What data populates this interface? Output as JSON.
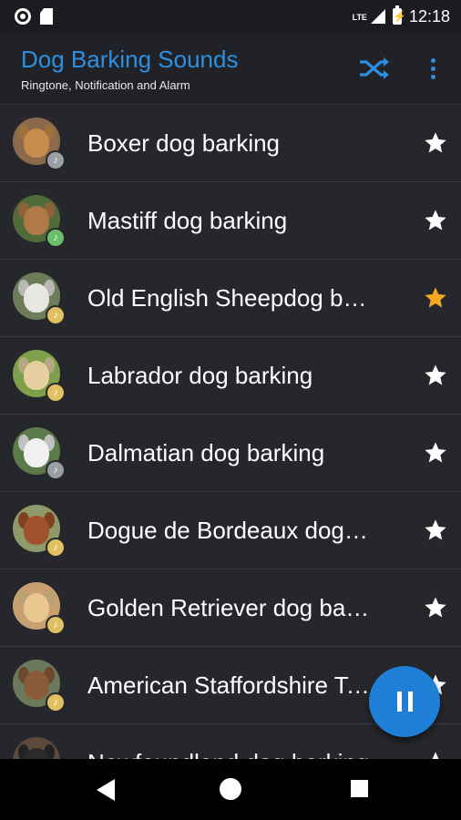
{
  "status_bar": {
    "time": "12:18",
    "network": "LTE"
  },
  "app_bar": {
    "title": "Dog Barking Sounds",
    "subtitle": "Ringtone, Notification and Alarm",
    "shuffle_icon": "shuffle-icon",
    "more_icon": "more-vert-icon"
  },
  "colors": {
    "accent": "#2e8fe0",
    "favorite": "#f5a623",
    "star": "#ffffff",
    "list_bg": "#26272c",
    "fab": "#1f7fd6"
  },
  "sounds": [
    {
      "title": "Boxer dog barking",
      "favorite": false,
      "avatar_bg": "#8a6a4a",
      "fur": "#c88b4e",
      "badge": "#9aa0a6"
    },
    {
      "title": "Mastiff dog barking",
      "favorite": false,
      "avatar_bg": "#4f6b3a",
      "fur": "#b07a48",
      "badge": "#6bbf6b"
    },
    {
      "title": "Old English Sheepdog barking",
      "favorite": true,
      "avatar_bg": "#6d7d5a",
      "fur": "#e8e6e0",
      "badge": "#e0c060"
    },
    {
      "title": "Labrador dog barking",
      "favorite": false,
      "avatar_bg": "#7fa04a",
      "fur": "#e6cfa0",
      "badge": "#e0c060"
    },
    {
      "title": "Dalmatian dog barking",
      "favorite": false,
      "avatar_bg": "#5b7a4a",
      "fur": "#f0f0f0",
      "badge": "#9aa0a6"
    },
    {
      "title": "Dogue de Bordeaux dog barking",
      "favorite": false,
      "avatar_bg": "#8e9a6a",
      "fur": "#a0522d",
      "badge": "#e0c060"
    },
    {
      "title": "Golden Retriever dog barking",
      "favorite": false,
      "avatar_bg": "#c8a070",
      "fur": "#e8c890",
      "badge": "#e0c060"
    },
    {
      "title": "American Staffordshire Terrier barking",
      "favorite": false,
      "avatar_bg": "#6a7a5a",
      "fur": "#8a5a3a",
      "badge": "#e0c060"
    },
    {
      "title": "Newfoundland dog barking",
      "favorite": false,
      "avatar_bg": "#5a4a3a",
      "fur": "#2a2a2a",
      "badge": "#9aa0a6"
    }
  ],
  "fab": {
    "icon": "pause-icon"
  },
  "nav_bar": {
    "back_icon": "back-icon",
    "home_icon": "home-icon",
    "recents_icon": "recents-icon"
  }
}
